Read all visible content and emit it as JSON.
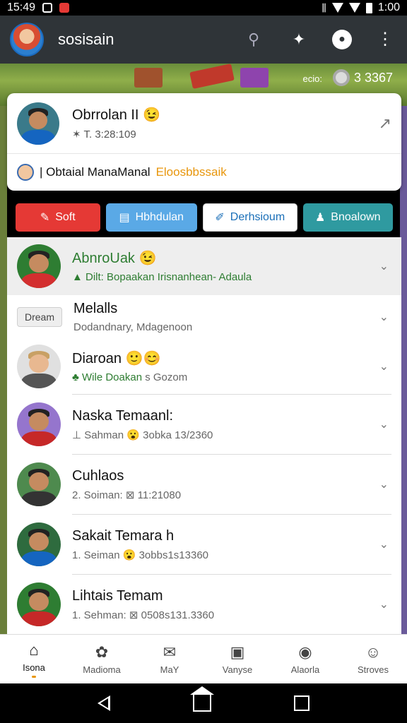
{
  "status_bar": {
    "time_left": "15:49",
    "time_right": "1:00"
  },
  "app_bar": {
    "title": "sosisain"
  },
  "banner": {
    "label": "ecio:",
    "coins": "3 3367"
  },
  "profile_card": {
    "name": "Obrrolan II",
    "emoji": "😉",
    "subtitle": "3:28:109",
    "sub_prefix": "✶ T.",
    "bottom_text": "| Obtaial ManaManal",
    "bottom_highlight": "Eloosbbssaik"
  },
  "action_buttons": [
    {
      "label": "Soft",
      "icon": "pencil-icon"
    },
    {
      "label": "Hbhdulan",
      "icon": "document-icon"
    },
    {
      "label": "Derhsioum",
      "icon": "edit-icon"
    },
    {
      "label": "Bnoalown",
      "icon": "person-icon"
    }
  ],
  "friends": [
    {
      "name": "AbnroUak",
      "emoji": "😉",
      "line": "▲ Dilt: Bopaakan Irisnanhean- Adaula",
      "highlight": true,
      "chevron": "⌄",
      "shirt": "#d32f2f",
      "bg": "#2e7d32"
    },
    {
      "name": "Melalls",
      "name_suffix": "",
      "line": "Dodandnary, Mdagenoon",
      "pill": "Dream",
      "chevron": "⌄"
    },
    {
      "name": "Diaroan",
      "emoji": "🙂😊",
      "line": "♣ Wile Doakan",
      "line_tail": "s Gozom",
      "chevron": "⌄",
      "shirt": "#555",
      "bg": "#e0e0e0"
    },
    {
      "name": "Naska Temaanl:",
      "line": "⊥ Sahman",
      "emoji_line": "😮",
      "line_tail": "3obka 13/2360",
      "chevron": "⌄",
      "shirt": "#c62828",
      "bg": "#9575cd"
    },
    {
      "name": "Cuhlaos",
      "line": "2. Soiman:",
      "line_tail": "⊠ 11:21080",
      "chevron": "⌄",
      "shirt": "#333",
      "bg": "#4e8a4e"
    },
    {
      "name": "Sakait Temara h",
      "line": "1. Seiman",
      "emoji_line": "😮",
      "line_tail": "3obbs1s13360",
      "chevron": "⌄",
      "shirt": "#1565c0",
      "bg": "#2e6b3e"
    },
    {
      "name": "Lihtais Temam",
      "line": "1. Sehman:",
      "line_tail": "⊠ 0508s131.3360",
      "chevron": "⌄",
      "shirt": "#c62828",
      "bg": "#2e7d32"
    }
  ],
  "bottom_nav": [
    {
      "label": "Isona",
      "icon": "home-icon",
      "active": true
    },
    {
      "label": "Madioma",
      "icon": "flower-icon"
    },
    {
      "label": "MaY",
      "icon": "mail-icon"
    },
    {
      "label": "Vanyse",
      "icon": "chat-icon"
    },
    {
      "label": "Alaorla",
      "icon": "camera-icon"
    },
    {
      "label": "Stroves",
      "icon": "profile-icon"
    }
  ]
}
